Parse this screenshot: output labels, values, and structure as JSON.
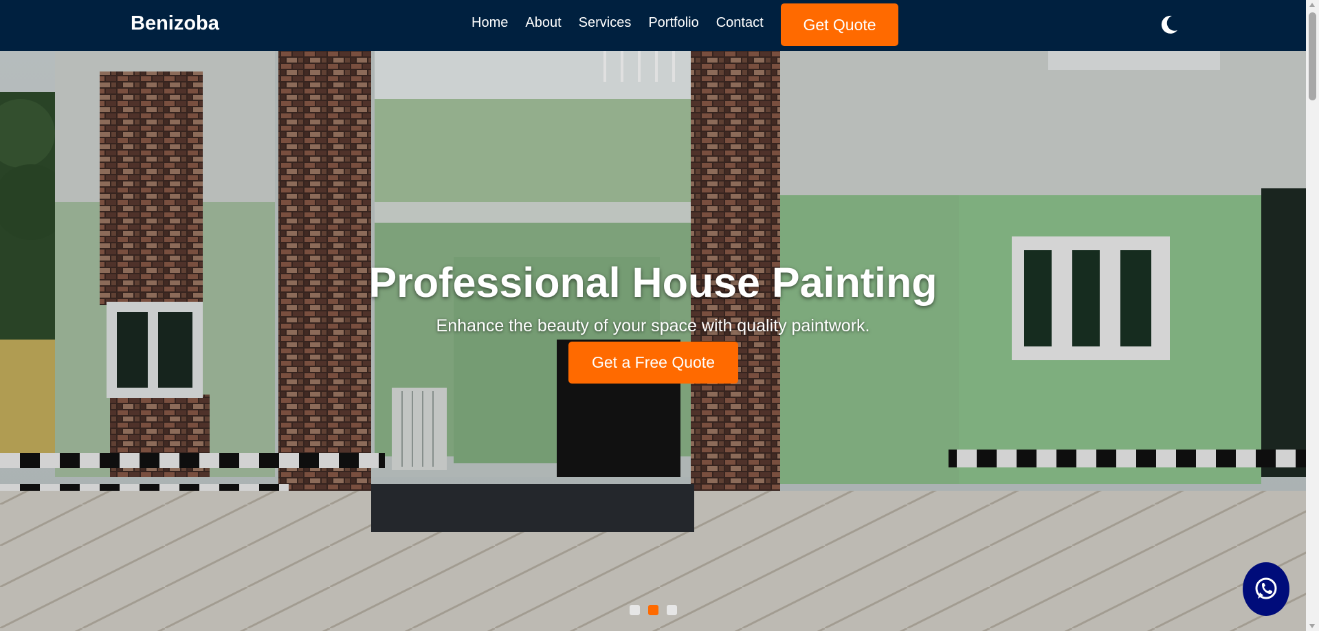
{
  "brand": {
    "name": "Benizoba"
  },
  "nav": {
    "items": [
      {
        "label": "Home"
      },
      {
        "label": "About"
      },
      {
        "label": "Services"
      },
      {
        "label": "Portfolio"
      },
      {
        "label": "Contact"
      }
    ],
    "cta_label": "Get Quote",
    "theme_toggle_icon": "moon-icon"
  },
  "hero": {
    "title": "Professional House Painting",
    "subtitle": "Enhance the beauty of your space with quality paintwork.",
    "cta_label": "Get a Free Quote",
    "slides_total": 3,
    "active_slide": 2
  },
  "floating": {
    "whatsapp_icon": "whatsapp-icon"
  },
  "colors": {
    "navbar": "#00203f",
    "accent": "#ff6a00",
    "whatsapp": "#000c7a"
  }
}
